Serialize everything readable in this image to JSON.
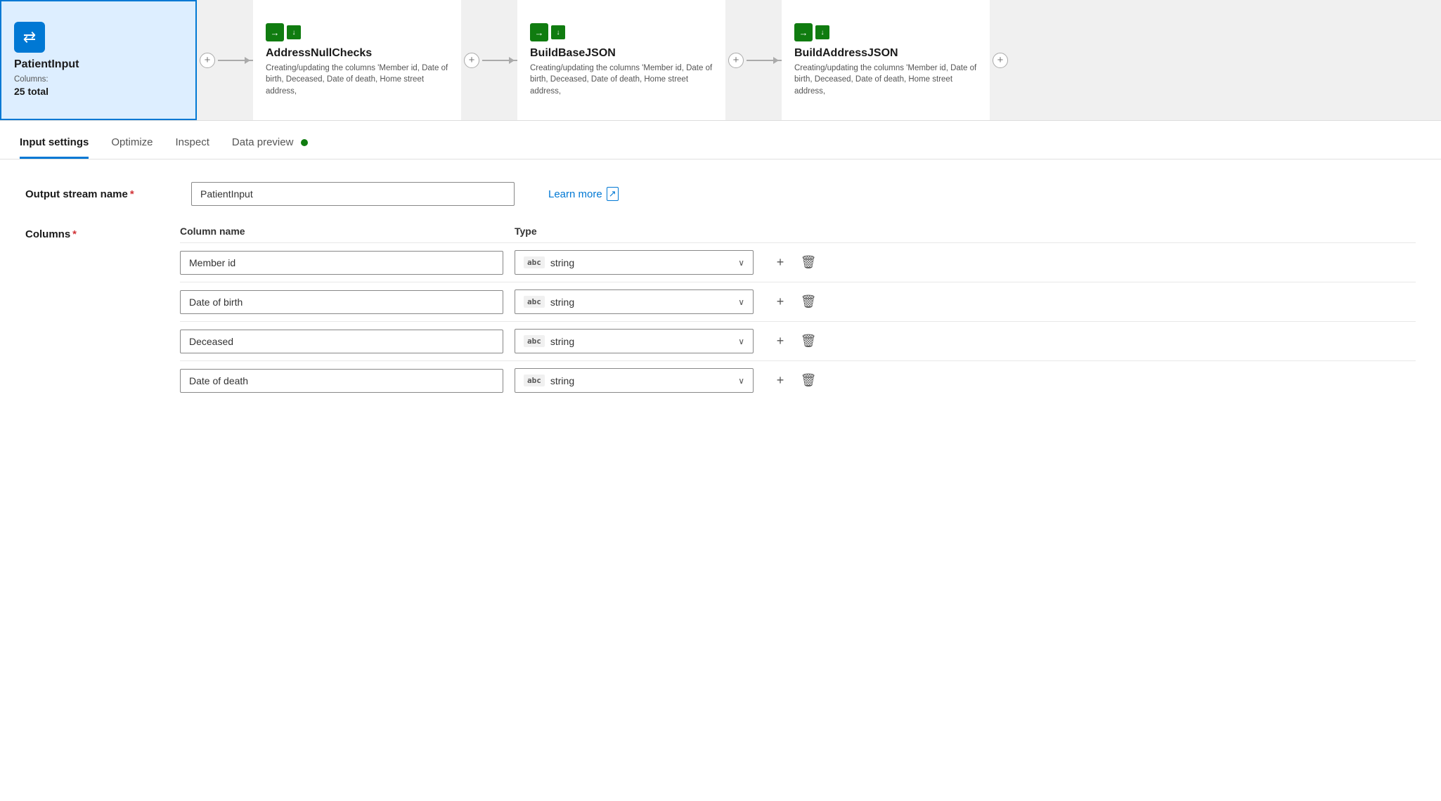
{
  "pipeline": {
    "nodes": [
      {
        "id": "patient-input",
        "title": "PatientInput",
        "subtitle": "Columns:",
        "count": "25 total",
        "highlighted": true,
        "icon_type": "source"
      },
      {
        "id": "address-null-checks",
        "title": "AddressNullChecks",
        "desc": "Creating/updating the columns 'Member id, Date of birth, Deceased, Date of death, Home street address,",
        "icon_type": "transform"
      },
      {
        "id": "build-base-json",
        "title": "BuildBaseJSON",
        "desc": "Creating/updating the columns 'Member id, Date of birth, Deceased, Date of death, Home street address,",
        "icon_type": "transform"
      },
      {
        "id": "build-address-json",
        "title": "BuildAddressJSON",
        "desc": "Creating/updating the columns 'Member id, Date of birth, Deceased, Date of death, Home street address,",
        "icon_type": "transform"
      }
    ]
  },
  "tabs": [
    {
      "id": "input-settings",
      "label": "Input settings",
      "active": true
    },
    {
      "id": "optimize",
      "label": "Optimize",
      "active": false
    },
    {
      "id": "inspect",
      "label": "Inspect",
      "active": false
    },
    {
      "id": "data-preview",
      "label": "Data preview",
      "active": false,
      "has_dot": true
    }
  ],
  "form": {
    "output_stream_label": "Output stream name",
    "output_stream_required": true,
    "output_stream_value": "PatientInput",
    "learn_more_label": "Learn more",
    "columns_label": "Columns",
    "columns_required": true,
    "column_name_header": "Column name",
    "type_header": "Type"
  },
  "columns": [
    {
      "id": "col-1",
      "name": "Member id",
      "type": "string",
      "type_badge": "abc"
    },
    {
      "id": "col-2",
      "name": "Date of birth",
      "type": "string",
      "type_badge": "abc"
    },
    {
      "id": "col-3",
      "name": "Deceased",
      "type": "string",
      "type_badge": "abc"
    },
    {
      "id": "col-4",
      "name": "Date of death",
      "type": "string",
      "type_badge": "abc"
    }
  ],
  "actions": {
    "add_label": "+",
    "delete_label": "🗑"
  }
}
